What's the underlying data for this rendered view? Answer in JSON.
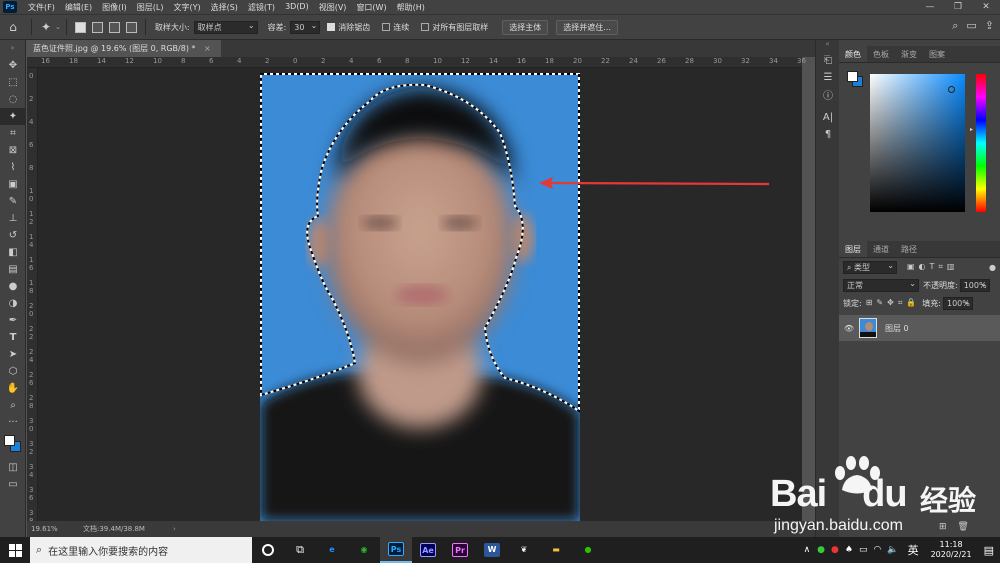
{
  "menu": [
    "文件(F)",
    "编辑(E)",
    "图像(I)",
    "图层(L)",
    "文字(Y)",
    "选择(S)",
    "滤镜(T)",
    "3D(D)",
    "视图(V)",
    "窗口(W)",
    "帮助(H)"
  ],
  "app_icon": "Ps",
  "options": {
    "sample_size_label": "取样大小:",
    "sample_size_value": "取样点",
    "tolerance_label": "容差:",
    "tolerance_value": "30",
    "antialias_label": "消除锯齿",
    "contiguous_label": "连续",
    "sample_all_label": "对所有图层取样",
    "select_subject": "选择主体",
    "select_mask": "选择并遮住..."
  },
  "document": {
    "tab_title": "蓝色证件照.jpg @ 19.6% (图层 0, RGB/8) *",
    "zoom": "19.61%",
    "doc_size": "文档:39.4M/38.8M"
  },
  "ruler_h": [
    "16",
    "18",
    "14",
    "12",
    "10",
    "8",
    "6",
    "4",
    "2",
    "0",
    "2",
    "4",
    "6",
    "8",
    "10",
    "12",
    "14",
    "16",
    "18",
    "20",
    "22",
    "24",
    "26",
    "28",
    "30",
    "32",
    "34",
    "36"
  ],
  "ruler_v": [
    "0",
    "2",
    "4",
    "6",
    "8",
    "1 0",
    "1 2",
    "1 4",
    "1 6",
    "1 8",
    "2 0",
    "2 2",
    "2 4",
    "2 6",
    "2 8",
    "3 0",
    "3 2",
    "3 4",
    "3 6",
    "3 8"
  ],
  "color_panel": {
    "tabs": [
      "颜色",
      "色板",
      "渐变",
      "图案"
    ],
    "fg": "#ffffff",
    "bg": "#1e7fd6",
    "hue_color": "#0a8cff"
  },
  "layers_panel": {
    "tabs": [
      "图层",
      "通道",
      "路径"
    ],
    "filter_label": "类型",
    "blend_mode": "正常",
    "opacity_label": "不透明度:",
    "opacity_value": "100%",
    "lock_label": "锁定:",
    "fill_label": "填充:",
    "fill_value": "100%",
    "layers": [
      {
        "name": "图层 0"
      }
    ]
  },
  "taskbar": {
    "search_placeholder": "在这里输入你要搜索的内容",
    "apps": [
      {
        "name": "edge",
        "label": "e",
        "color": "#1e90ff"
      },
      {
        "name": "browser",
        "label": "◉",
        "color": "#2eb82e"
      },
      {
        "name": "photoshop",
        "label": "Ps",
        "color": "#31a8ff"
      },
      {
        "name": "after-effects",
        "label": "Ae",
        "color": "#9999ff"
      },
      {
        "name": "premiere",
        "label": "Pr",
        "color": "#ea77ff"
      },
      {
        "name": "word",
        "label": "W",
        "color": "#ffffff"
      },
      {
        "name": "feather",
        "label": "❦",
        "color": "#ffffff"
      },
      {
        "name": "file-explorer",
        "label": "▬",
        "color": "#f3c13a"
      },
      {
        "name": "wechat",
        "label": "●",
        "color": "#2dc100"
      }
    ],
    "ime": "英",
    "time": "11:18",
    "date": "2020/2/21"
  },
  "watermark": {
    "brand": "Bai",
    "brand2": "du",
    "brand_cn": "经验",
    "url": "jingyan.baidu.com"
  }
}
